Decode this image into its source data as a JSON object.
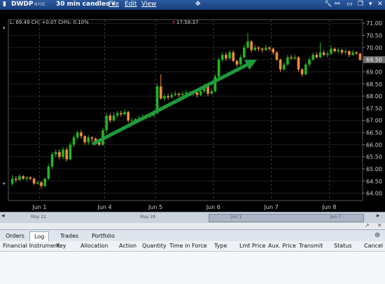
{
  "window": {
    "symbol": "DWDP",
    "exchange": "NYSE",
    "candle_setting": "30 min candles",
    "menus": [
      "File",
      "Edit",
      "View"
    ]
  },
  "chart_readout": {
    "last": "L: 69.49 CH: +0.07 CH%: 0.10%",
    "time": "17:58:37"
  },
  "chart_data": {
    "type": "candlestick",
    "ylim": [
      63.7,
      71.15
    ],
    "y_ticks": [
      "71.00",
      "70.50",
      "70.00",
      "69.50",
      "69.00",
      "68.50",
      "68.00",
      "67.50",
      "67.00",
      "66.50",
      "66.00",
      "65.50",
      "65.00",
      "64.50",
      "64.00"
    ],
    "x_ticks": [
      "Jun 1",
      "Jun 4",
      "Jun 5",
      "Jun 6",
      "Jun 7",
      "Jun 8"
    ],
    "current_price": "69.50",
    "up_color": "#22b522",
    "down_color": "#f08a3c",
    "candles": [
      [
        64.4,
        64.6,
        64.75,
        64.3
      ],
      [
        64.6,
        64.55,
        64.7,
        64.45
      ],
      [
        64.55,
        64.7,
        64.8,
        64.5
      ],
      [
        64.7,
        64.6,
        64.75,
        64.55
      ],
      [
        64.6,
        64.65,
        64.7,
        64.5
      ],
      [
        64.65,
        64.6,
        64.7,
        64.55
      ],
      [
        64.6,
        64.4,
        64.65,
        64.35
      ],
      [
        64.4,
        64.45,
        64.5,
        64.35
      ],
      [
        64.45,
        64.3,
        64.5,
        64.2
      ],
      [
        64.3,
        64.6,
        64.65,
        64.25
      ],
      [
        64.6,
        65.1,
        65.2,
        64.55
      ],
      [
        65.1,
        65.6,
        65.7,
        65.0
      ],
      [
        65.6,
        65.7,
        65.8,
        65.5
      ],
      [
        65.7,
        65.5,
        65.8,
        65.4
      ],
      [
        65.5,
        65.8,
        65.9,
        65.4
      ],
      [
        65.8,
        65.4,
        65.9,
        65.3
      ],
      [
        65.4,
        66.0,
        66.1,
        65.35
      ],
      [
        66.0,
        66.3,
        66.4,
        65.9
      ],
      [
        66.3,
        66.5,
        66.6,
        66.2
      ],
      [
        66.5,
        66.35,
        66.6,
        66.25
      ],
      [
        66.35,
        66.1,
        66.4,
        66.0
      ],
      [
        66.1,
        66.3,
        66.4,
        66.0
      ],
      [
        66.3,
        66.25,
        66.35,
        66.1
      ],
      [
        66.25,
        66.1,
        66.3,
        66.0
      ],
      [
        66.1,
        66.0,
        66.2,
        65.95
      ],
      [
        66.0,
        66.6,
        66.7,
        65.95
      ],
      [
        66.6,
        67.2,
        67.3,
        66.5
      ],
      [
        67.2,
        67.0,
        67.3,
        66.9
      ],
      [
        67.0,
        67.2,
        67.35,
        66.95
      ],
      [
        67.2,
        67.3,
        67.4,
        67.1
      ],
      [
        67.3,
        67.25,
        67.4,
        67.15
      ],
      [
        67.25,
        67.35,
        67.45,
        67.2
      ],
      [
        67.35,
        67.0,
        67.4,
        66.9
      ],
      [
        67.0,
        67.0,
        67.1,
        66.9
      ],
      [
        67.0,
        67.05,
        67.1,
        66.95
      ],
      [
        67.05,
        67.1,
        67.2,
        67.0
      ],
      [
        67.1,
        67.15,
        67.25,
        67.05
      ],
      [
        67.15,
        67.15,
        67.2,
        67.05
      ],
      [
        67.15,
        67.2,
        67.3,
        67.1
      ],
      [
        67.2,
        67.3,
        67.4,
        67.15
      ],
      [
        67.3,
        68.4,
        68.5,
        67.25
      ],
      [
        68.4,
        67.9,
        68.9,
        67.85
      ],
      [
        67.9,
        68.0,
        68.1,
        67.8
      ],
      [
        68.0,
        67.95,
        68.1,
        67.85
      ],
      [
        67.95,
        68.05,
        68.15,
        67.9
      ],
      [
        68.05,
        68.1,
        68.2,
        68.0
      ],
      [
        68.1,
        68.05,
        68.15,
        67.95
      ],
      [
        68.05,
        68.1,
        68.2,
        68.0
      ],
      [
        68.1,
        68.15,
        68.25,
        68.05
      ],
      [
        68.15,
        68.1,
        68.2,
        68.05
      ],
      [
        68.1,
        68.15,
        68.25,
        68.0
      ],
      [
        68.15,
        68.05,
        68.25,
        67.95
      ],
      [
        68.05,
        68.2,
        68.3,
        68.0
      ],
      [
        68.2,
        68.4,
        68.5,
        68.15
      ],
      [
        68.4,
        68.1,
        68.45,
        68.0
      ],
      [
        68.1,
        68.2,
        68.3,
        68.05
      ],
      [
        68.2,
        68.8,
        68.9,
        68.15
      ],
      [
        68.8,
        69.5,
        69.6,
        68.75
      ],
      [
        69.5,
        69.7,
        69.8,
        69.4
      ],
      [
        69.7,
        69.55,
        69.8,
        69.45
      ],
      [
        69.55,
        69.8,
        69.9,
        69.5
      ],
      [
        69.8,
        69.45,
        69.9,
        69.4
      ],
      [
        69.45,
        69.3,
        69.5,
        69.2
      ],
      [
        69.3,
        69.6,
        69.7,
        69.25
      ],
      [
        69.6,
        70.0,
        70.1,
        69.55
      ],
      [
        70.0,
        70.25,
        70.6,
        69.95
      ],
      [
        70.25,
        69.9,
        70.3,
        69.8
      ],
      [
        69.9,
        70.0,
        70.1,
        69.85
      ],
      [
        70.0,
        69.95,
        70.05,
        69.85
      ],
      [
        69.95,
        69.9,
        70.0,
        69.8
      ],
      [
        69.9,
        70.0,
        70.1,
        69.85
      ],
      [
        70.0,
        69.95,
        70.05,
        69.85
      ],
      [
        69.95,
        69.8,
        70.0,
        69.7
      ],
      [
        69.8,
        69.5,
        69.85,
        69.45
      ],
      [
        69.5,
        69.1,
        69.55,
        69.0
      ],
      [
        69.1,
        69.3,
        69.4,
        69.05
      ],
      [
        69.3,
        69.6,
        69.7,
        69.25
      ],
      [
        69.6,
        69.55,
        69.7,
        69.5
      ],
      [
        69.55,
        69.6,
        69.7,
        69.5
      ],
      [
        69.6,
        69.1,
        69.65,
        69.0
      ],
      [
        69.1,
        68.9,
        69.15,
        68.8
      ],
      [
        68.9,
        69.3,
        69.4,
        68.85
      ],
      [
        69.3,
        69.5,
        69.6,
        69.2
      ],
      [
        69.5,
        69.7,
        69.8,
        69.45
      ],
      [
        69.7,
        69.6,
        69.8,
        69.55
      ],
      [
        69.6,
        69.8,
        70.2,
        69.55
      ],
      [
        69.8,
        69.7,
        69.9,
        69.65
      ],
      [
        69.7,
        69.75,
        69.85,
        69.6
      ],
      [
        69.75,
        69.95,
        70.1,
        69.7
      ],
      [
        69.95,
        69.85,
        70.0,
        69.8
      ],
      [
        69.85,
        69.9,
        70.0,
        69.75
      ],
      [
        69.9,
        69.8,
        69.95,
        69.7
      ],
      [
        69.8,
        69.85,
        69.95,
        69.7
      ],
      [
        69.85,
        69.7,
        69.9,
        69.6
      ],
      [
        69.7,
        69.8,
        69.9,
        69.65
      ],
      [
        69.8,
        69.75,
        69.85,
        69.7
      ],
      [
        69.75,
        69.5,
        69.8,
        69.45
      ]
    ],
    "annotation": "green trend arrow"
  },
  "navigator_labels": [
    "May 22",
    "May 28",
    "Jun 1",
    "Jun 7"
  ],
  "tabs": [
    "Orders",
    "Log",
    "Trades",
    "Portfolio"
  ],
  "active_tab": "Log",
  "columns": [
    "Financial Instrument",
    "Key",
    "Allocation",
    "Action",
    "Quantity",
    "Time in Force",
    "Type",
    "Lmt Price",
    "Aux. Price",
    "Transmit",
    "Status",
    "Cancel"
  ]
}
